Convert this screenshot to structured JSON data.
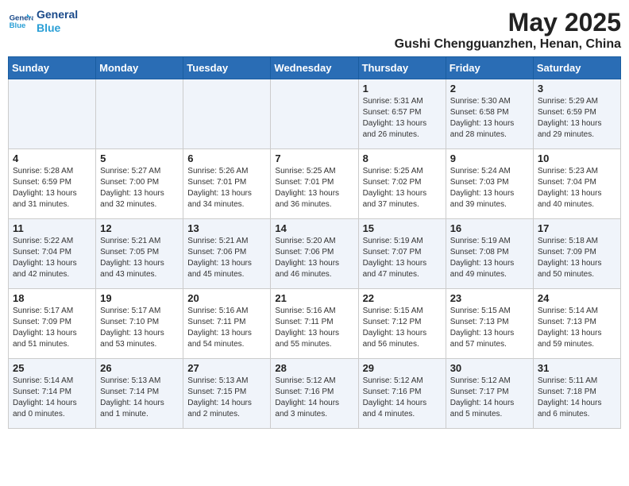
{
  "header": {
    "logo_line1": "General",
    "logo_line2": "Blue",
    "month": "May 2025",
    "location": "Gushi Chengguanzhen, Henan, China"
  },
  "weekdays": [
    "Sunday",
    "Monday",
    "Tuesday",
    "Wednesday",
    "Thursday",
    "Friday",
    "Saturday"
  ],
  "weeks": [
    [
      {
        "day": "",
        "info": ""
      },
      {
        "day": "",
        "info": ""
      },
      {
        "day": "",
        "info": ""
      },
      {
        "day": "",
        "info": ""
      },
      {
        "day": "1",
        "info": "Sunrise: 5:31 AM\nSunset: 6:57 PM\nDaylight: 13 hours\nand 26 minutes."
      },
      {
        "day": "2",
        "info": "Sunrise: 5:30 AM\nSunset: 6:58 PM\nDaylight: 13 hours\nand 28 minutes."
      },
      {
        "day": "3",
        "info": "Sunrise: 5:29 AM\nSunset: 6:59 PM\nDaylight: 13 hours\nand 29 minutes."
      }
    ],
    [
      {
        "day": "4",
        "info": "Sunrise: 5:28 AM\nSunset: 6:59 PM\nDaylight: 13 hours\nand 31 minutes."
      },
      {
        "day": "5",
        "info": "Sunrise: 5:27 AM\nSunset: 7:00 PM\nDaylight: 13 hours\nand 32 minutes."
      },
      {
        "day": "6",
        "info": "Sunrise: 5:26 AM\nSunset: 7:01 PM\nDaylight: 13 hours\nand 34 minutes."
      },
      {
        "day": "7",
        "info": "Sunrise: 5:25 AM\nSunset: 7:01 PM\nDaylight: 13 hours\nand 36 minutes."
      },
      {
        "day": "8",
        "info": "Sunrise: 5:25 AM\nSunset: 7:02 PM\nDaylight: 13 hours\nand 37 minutes."
      },
      {
        "day": "9",
        "info": "Sunrise: 5:24 AM\nSunset: 7:03 PM\nDaylight: 13 hours\nand 39 minutes."
      },
      {
        "day": "10",
        "info": "Sunrise: 5:23 AM\nSunset: 7:04 PM\nDaylight: 13 hours\nand 40 minutes."
      }
    ],
    [
      {
        "day": "11",
        "info": "Sunrise: 5:22 AM\nSunset: 7:04 PM\nDaylight: 13 hours\nand 42 minutes."
      },
      {
        "day": "12",
        "info": "Sunrise: 5:21 AM\nSunset: 7:05 PM\nDaylight: 13 hours\nand 43 minutes."
      },
      {
        "day": "13",
        "info": "Sunrise: 5:21 AM\nSunset: 7:06 PM\nDaylight: 13 hours\nand 45 minutes."
      },
      {
        "day": "14",
        "info": "Sunrise: 5:20 AM\nSunset: 7:06 PM\nDaylight: 13 hours\nand 46 minutes."
      },
      {
        "day": "15",
        "info": "Sunrise: 5:19 AM\nSunset: 7:07 PM\nDaylight: 13 hours\nand 47 minutes."
      },
      {
        "day": "16",
        "info": "Sunrise: 5:19 AM\nSunset: 7:08 PM\nDaylight: 13 hours\nand 49 minutes."
      },
      {
        "day": "17",
        "info": "Sunrise: 5:18 AM\nSunset: 7:09 PM\nDaylight: 13 hours\nand 50 minutes."
      }
    ],
    [
      {
        "day": "18",
        "info": "Sunrise: 5:17 AM\nSunset: 7:09 PM\nDaylight: 13 hours\nand 51 minutes."
      },
      {
        "day": "19",
        "info": "Sunrise: 5:17 AM\nSunset: 7:10 PM\nDaylight: 13 hours\nand 53 minutes."
      },
      {
        "day": "20",
        "info": "Sunrise: 5:16 AM\nSunset: 7:11 PM\nDaylight: 13 hours\nand 54 minutes."
      },
      {
        "day": "21",
        "info": "Sunrise: 5:16 AM\nSunset: 7:11 PM\nDaylight: 13 hours\nand 55 minutes."
      },
      {
        "day": "22",
        "info": "Sunrise: 5:15 AM\nSunset: 7:12 PM\nDaylight: 13 hours\nand 56 minutes."
      },
      {
        "day": "23",
        "info": "Sunrise: 5:15 AM\nSunset: 7:13 PM\nDaylight: 13 hours\nand 57 minutes."
      },
      {
        "day": "24",
        "info": "Sunrise: 5:14 AM\nSunset: 7:13 PM\nDaylight: 13 hours\nand 59 minutes."
      }
    ],
    [
      {
        "day": "25",
        "info": "Sunrise: 5:14 AM\nSunset: 7:14 PM\nDaylight: 14 hours\nand 0 minutes."
      },
      {
        "day": "26",
        "info": "Sunrise: 5:13 AM\nSunset: 7:14 PM\nDaylight: 14 hours\nand 1 minute."
      },
      {
        "day": "27",
        "info": "Sunrise: 5:13 AM\nSunset: 7:15 PM\nDaylight: 14 hours\nand 2 minutes."
      },
      {
        "day": "28",
        "info": "Sunrise: 5:12 AM\nSunset: 7:16 PM\nDaylight: 14 hours\nand 3 minutes."
      },
      {
        "day": "29",
        "info": "Sunrise: 5:12 AM\nSunset: 7:16 PM\nDaylight: 14 hours\nand 4 minutes."
      },
      {
        "day": "30",
        "info": "Sunrise: 5:12 AM\nSunset: 7:17 PM\nDaylight: 14 hours\nand 5 minutes."
      },
      {
        "day": "31",
        "info": "Sunrise: 5:11 AM\nSunset: 7:18 PM\nDaylight: 14 hours\nand 6 minutes."
      }
    ]
  ]
}
